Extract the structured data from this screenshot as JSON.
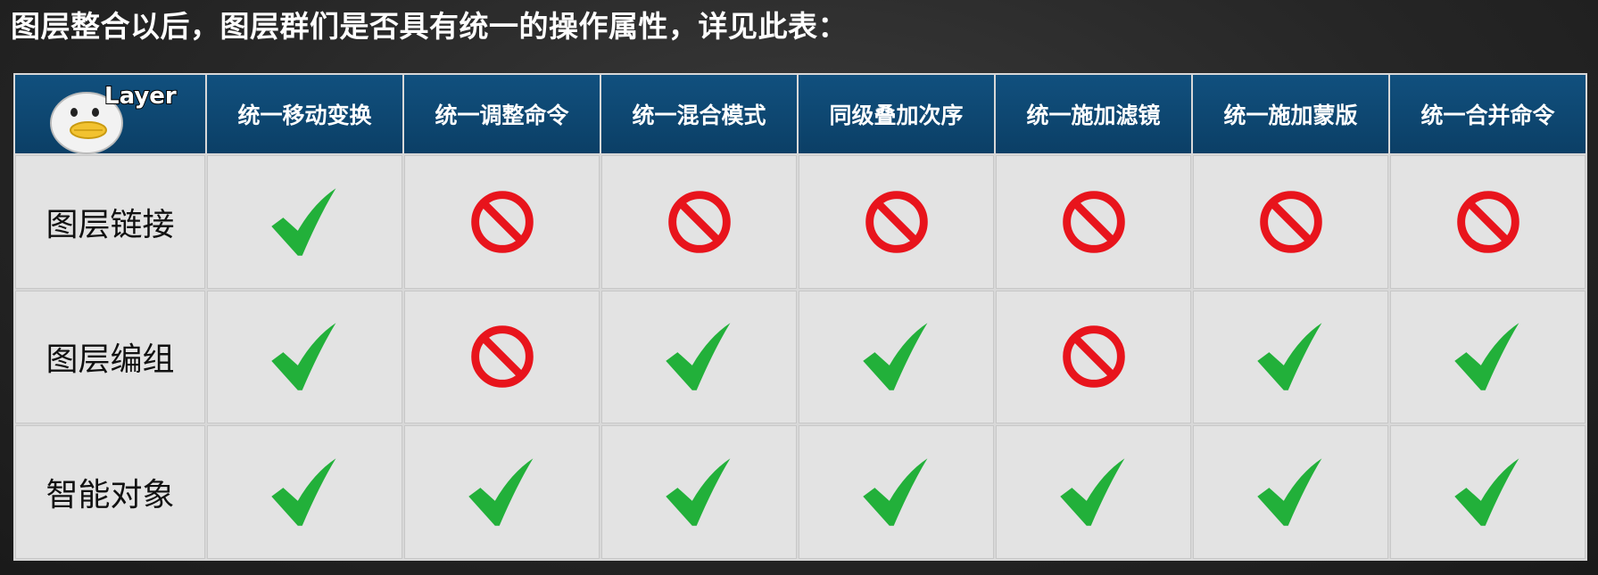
{
  "heading": "图层整合以后，图层群们是否具有统一的操作属性，详见此表：",
  "logo": {
    "text": "Layer",
    "icon": "mascot-logo-icon"
  },
  "columns": [
    "统一移动变换",
    "统一调整命令",
    "统一混合模式",
    "同级叠加次序",
    "统一施加滤镜",
    "统一施加蒙版",
    "统一合并命令"
  ],
  "rows": [
    {
      "label": "图层链接",
      "cells": [
        "check",
        "no",
        "no",
        "no",
        "no",
        "no",
        "no"
      ]
    },
    {
      "label": "图层编组",
      "cells": [
        "check",
        "no",
        "check",
        "check",
        "no",
        "check",
        "check"
      ]
    },
    {
      "label": "智能对象",
      "cells": [
        "check",
        "check",
        "check",
        "check",
        "check",
        "check",
        "check"
      ]
    }
  ],
  "colors": {
    "header_bg": "#0b3f66",
    "check": "#22b03a",
    "no": "#e8141c",
    "cell_bg": "#e3e3e3"
  }
}
